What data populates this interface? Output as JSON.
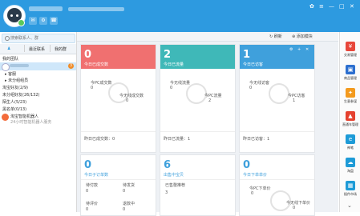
{
  "window_controls": {
    "skin": "✿",
    "menu": "≡",
    "minimize": "—",
    "restore": "□",
    "close": "✕"
  },
  "toolbar": {
    "icon1": "✉",
    "icon2": "⚙",
    "icon3": "☎"
  },
  "sidebar": {
    "search_placeholder": "搜索联系人、群",
    "tabs": [
      "最近联系",
      "我的群"
    ],
    "items": [
      {
        "label": "我的团队"
      },
      {
        "label": "客服"
      },
      {
        "label": "未分组组员"
      },
      {
        "label": "淘宝好友(2/9)"
      },
      {
        "label": "未分组好友(26/132)"
      },
      {
        "label": "陌生人(5/23)"
      },
      {
        "label": "黑名单(0/13)"
      },
      {
        "label": "淘宝智能机器人"
      },
      {
        "label": "24小时智能机器人服务"
      }
    ],
    "selected_badge": "3"
  },
  "main": {
    "refresh_label": "刷新",
    "add_module_label": "添加模块",
    "cards": [
      {
        "number": "0",
        "label": "今日已成交数",
        "sub1": "今PC成交数",
        "sub1_val": "0",
        "sub2": "今无线成交数",
        "sub2_val": "0",
        "footer": "昨日已成交数：0",
        "color": "#f07070"
      },
      {
        "number": "2",
        "label": "今日已流量",
        "sub1": "今无线流量",
        "sub1_val": "0",
        "sub2": "今PC流量",
        "sub2_val": "2",
        "footer": "昨日已流量：1",
        "color": "#3fb8b8"
      },
      {
        "number": "1",
        "label": "今日已访客",
        "sub1": "今无线访客",
        "sub1_val": "0",
        "sub2": "今PC访客",
        "sub2_val": "1",
        "footer": "昨日已访客：1",
        "color": "#3fa0dc"
      },
      {
        "number": "0",
        "label": "今日子订单数",
        "row1": [
          "待付款",
          "待发货"
        ],
        "row1_vals": [
          "0",
          "0"
        ],
        "row2": [
          "待评价",
          "退款中"
        ],
        "row2_vals": [
          "0",
          "0"
        ],
        "color": "#3fa0dc"
      },
      {
        "number": "6",
        "label": "出售中宝贝",
        "row1": [
          "已售罄推荐"
        ],
        "row1_vals": [
          "3"
        ],
        "color": "#3fa0dc"
      },
      {
        "number": "0",
        "label": "今日下单单价",
        "sub1": "今PC下单价",
        "sub1_val": "0",
        "sub2": "今无线下单价",
        "sub2_val": "0",
        "color": "#3fa0dc"
      }
    ],
    "card_controls": [
      "⚙",
      "+",
      "✕"
    ]
  },
  "right_apps": [
    {
      "label": "交易管理",
      "icon": "¥",
      "color": "#e8473b"
    },
    {
      "label": "商品管理",
      "icon": "▣",
      "color": "#2d6fcf"
    },
    {
      "label": "生意参谋",
      "icon": "✦",
      "color": "#f39a1e"
    },
    {
      "label": "直通车管理",
      "icon": "▲",
      "color": "#e5412f"
    },
    {
      "label": "神笔",
      "icon": "e",
      "color": "#1e9bd7"
    },
    {
      "label": "淘盘",
      "icon": "☁",
      "color": "#1e9bd7"
    },
    {
      "label": "插件市场",
      "icon": "▦",
      "color": "#1e9bd7"
    }
  ],
  "scroll_down": "⌄"
}
